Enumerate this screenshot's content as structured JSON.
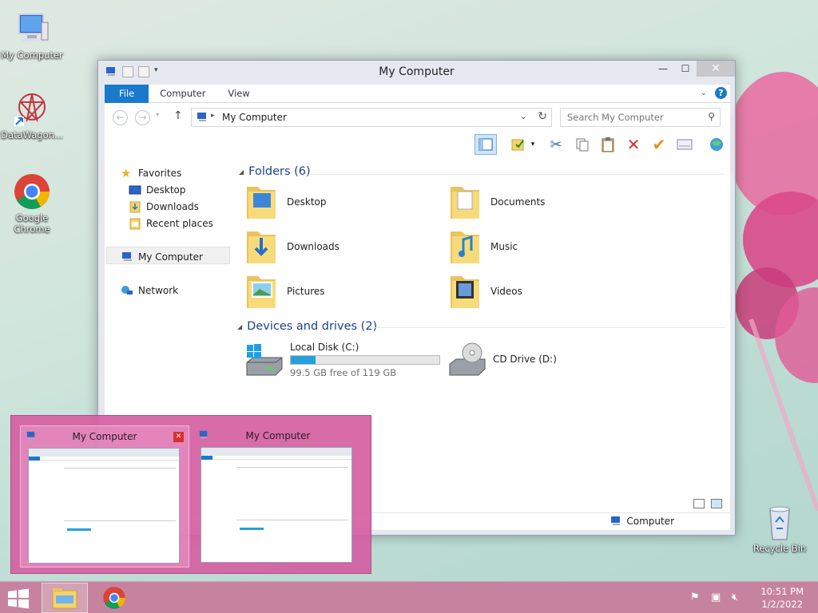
{
  "desktop": {
    "icons": [
      {
        "label": "My Computer"
      },
      {
        "label": "DataWagon..."
      },
      {
        "label": "Google Chrome"
      },
      {
        "label": "Recycle Bin"
      }
    ]
  },
  "window": {
    "title": "My Computer",
    "tabs": [
      {
        "label": "File"
      },
      {
        "label": "Computer"
      },
      {
        "label": "View"
      }
    ],
    "address": "My Computer",
    "search_placeholder": "Search My Computer",
    "nav": {
      "favorites": "Favorites",
      "desktop": "Desktop",
      "downloads": "Downloads",
      "recent": "Recent places",
      "computer": "My Computer",
      "network": "Network"
    },
    "folders_header": "Folders (6)",
    "folders": [
      {
        "label": "Desktop"
      },
      {
        "label": "Documents"
      },
      {
        "label": "Downloads"
      },
      {
        "label": "Music"
      },
      {
        "label": "Pictures"
      },
      {
        "label": "Videos"
      }
    ],
    "drives_header": "Devices and drives (2)",
    "drives": [
      {
        "label": "Local Disk (C:)",
        "free": "99.5 GB free of 119 GB",
        "used_fraction": 0.164
      },
      {
        "label": "CD Drive (D:)"
      }
    ],
    "status": "Computer"
  },
  "thumbnails": [
    {
      "title": "My Computer"
    },
    {
      "title": "My Computer"
    }
  ],
  "taskbar": {
    "time": "10:51 PM",
    "date": "1/2/2022"
  },
  "colors": {
    "accent": "#1979ca",
    "taskbar": "#c6839f",
    "thumb_panel": "#d460a2",
    "progress": "#26a0da"
  }
}
